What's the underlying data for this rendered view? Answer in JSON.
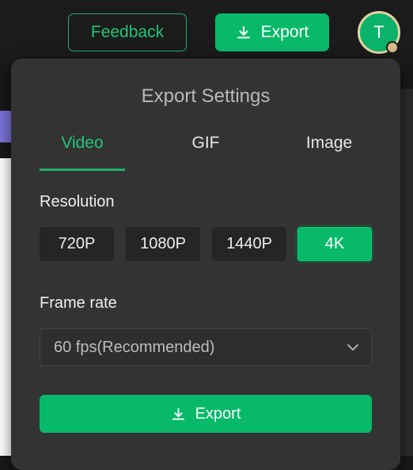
{
  "header": {
    "feedback_label": "Feedback",
    "export_label": "Export",
    "avatar_initial": "T"
  },
  "panel": {
    "title": "Export Settings",
    "tabs": [
      {
        "label": "Video",
        "active": true
      },
      {
        "label": "GIF",
        "active": false
      },
      {
        "label": "Image",
        "active": false
      }
    ],
    "resolution_label": "Resolution",
    "resolutions": [
      "720P",
      "1080P",
      "1440P",
      "4K"
    ],
    "selected_resolution": "4K",
    "framerate_label": "Frame rate",
    "framerate_value": "60 fps(Recommended)",
    "export_label": "Export"
  },
  "colors": {
    "accent": "#08b96a",
    "panel_bg": "#333333",
    "app_bg": "#1b1b1b"
  },
  "icons": {
    "export": "download-icon",
    "dropdown": "chevron-down-icon",
    "avatar_badge": "camera-badge-icon"
  }
}
